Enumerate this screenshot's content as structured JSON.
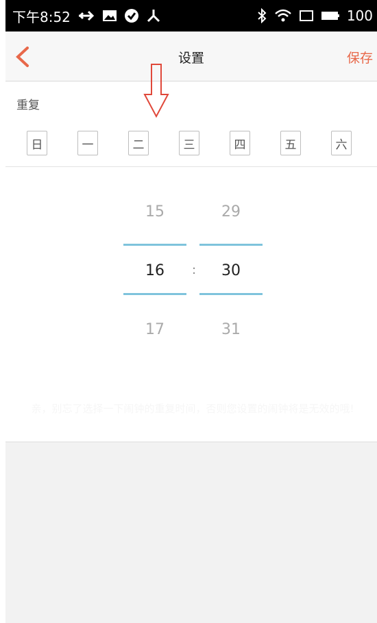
{
  "status_bar": {
    "time": "下午8:52",
    "battery": "100",
    "icons_left": [
      "usb-icon",
      "image-icon",
      "check-circle-icon",
      "share-icon"
    ],
    "icons_right": [
      "bluetooth-icon",
      "wifi-icon",
      "screen-icon",
      "battery-icon"
    ]
  },
  "header": {
    "title": "设置",
    "save_label": "保存",
    "back_icon": "chevron-left-icon",
    "accent_color": "#e8684a"
  },
  "repeat": {
    "label": "重复",
    "days": [
      "日",
      "一",
      "二",
      "三",
      "四",
      "五",
      "六"
    ]
  },
  "picker": {
    "hours": {
      "prev": "15",
      "current": "16",
      "next": "17"
    },
    "minutes": {
      "prev": "29",
      "current": "30",
      "next": "31"
    },
    "separator": ":",
    "line_color": "#7ec3dc"
  },
  "hint": "亲，别忘了选择一下闹钟的重复时间，否则您设置的闹钟将是无效的哦!"
}
